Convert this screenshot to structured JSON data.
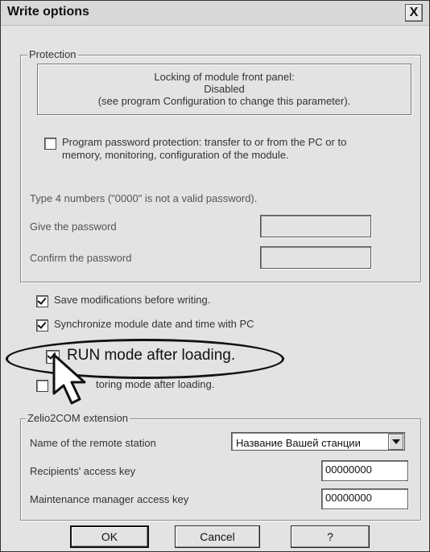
{
  "window": {
    "title": "Write options",
    "close_label": "X"
  },
  "protection": {
    "legend": "Protection",
    "info_lines": [
      "Locking of module front panel:",
      "Disabled",
      "(see program Configuration to change this parameter)."
    ],
    "password_protection_line1": "Program password protection: transfer to or from the PC or to",
    "password_protection_line2": "memory, monitoring, configuration of the module.",
    "password_protection_checked": false,
    "hint": "Type 4 numbers (\"0000\" is not a valid password).",
    "give_password_label": "Give the password",
    "confirm_password_label": "Confirm the password",
    "give_password_value": "",
    "confirm_password_value": ""
  },
  "options": {
    "save_modifications": {
      "label": "Save modifications before writing.",
      "checked": true
    },
    "synchronize_date": {
      "label": "Synchronize module date and time with PC",
      "checked": true
    },
    "run_mode": {
      "label": "RUN mode after loading.",
      "checked": true
    },
    "monitoring_mode": {
      "label": "toring mode after loading.",
      "checked": false
    }
  },
  "zelio": {
    "legend": "Zelio2COM extension",
    "station_label": "Name of the remote station",
    "station_value": "Название Вашей станции",
    "recipients_label": "Recipients' access key",
    "recipients_value": "00000000",
    "maintenance_label": "Maintenance manager access key",
    "maintenance_value": "00000000"
  },
  "buttons": {
    "ok": "OK",
    "cancel": "Cancel",
    "help": "?"
  }
}
